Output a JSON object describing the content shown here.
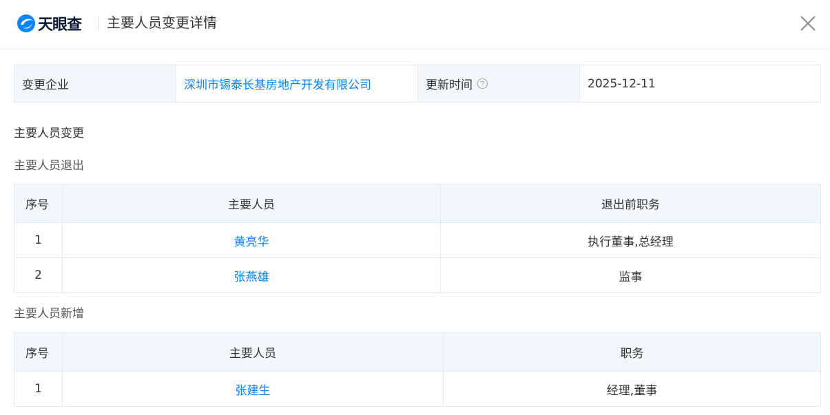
{
  "header": {
    "logo_text": "天眼查",
    "title": "主要人员变更详情",
    "close_icon": "close-icon"
  },
  "info": {
    "company_label": "变更企业",
    "company_name": "深圳市锡泰长基房地产开发有限公司",
    "update_label": "更新时间",
    "update_help_icon": "question-circle-icon",
    "update_value": "2025-12-11"
  },
  "section_title": "主要人员变更",
  "exit": {
    "title": "主要人员退出",
    "columns": [
      "序号",
      "主要人员",
      "退出前职务"
    ],
    "rows": [
      {
        "index": "1",
        "name": "黄亮华",
        "position": "执行董事,总经理"
      },
      {
        "index": "2",
        "name": "张燕雄",
        "position": "监事"
      }
    ]
  },
  "added": {
    "title": "主要人员新增",
    "columns": [
      "序号",
      "主要人员",
      "职务"
    ],
    "rows": [
      {
        "index": "1",
        "name": "张建生",
        "position": "经理,董事"
      }
    ]
  },
  "colors": {
    "link": "#0084ff",
    "header_bg": "#f2f7fc",
    "border": "#e6e9ef"
  }
}
